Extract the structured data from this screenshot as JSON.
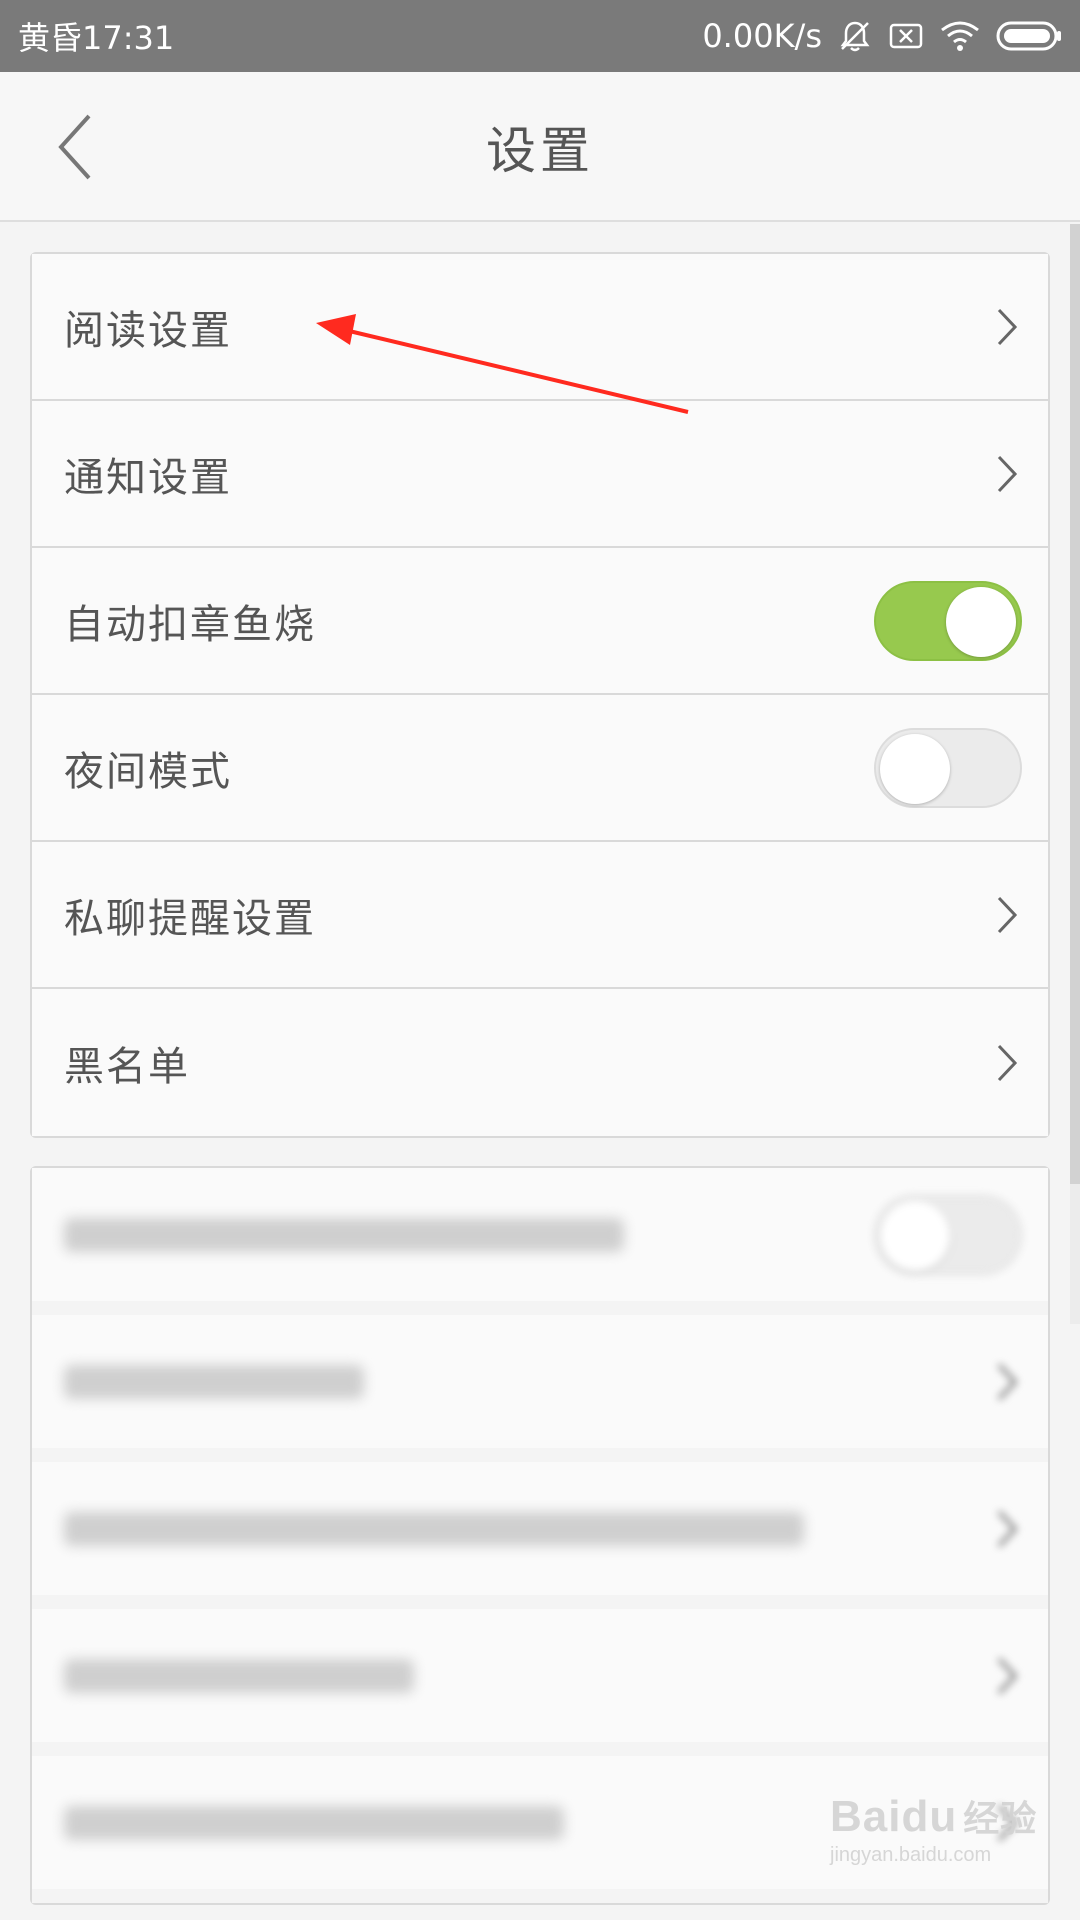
{
  "status_bar": {
    "time": "黄昏17:31",
    "network_speed": "0.00K/s",
    "icons": [
      "bell-off-icon",
      "sim-off-icon",
      "wifi-icon",
      "battery-icon"
    ]
  },
  "header": {
    "title": "设置",
    "back_icon": "chevron-left-icon"
  },
  "settings_group_1": {
    "items": [
      {
        "label": "阅读设置",
        "control": "chevron"
      },
      {
        "label": "通知设置",
        "control": "chevron"
      },
      {
        "label": "自动扣章鱼烧",
        "control": "toggle",
        "on": true
      },
      {
        "label": "夜间模式",
        "control": "toggle",
        "on": false
      },
      {
        "label": "私聊提醒设置",
        "control": "chevron"
      },
      {
        "label": "黑名单",
        "control": "chevron"
      }
    ]
  },
  "settings_group_2": {
    "note": "blurred rows",
    "items": [
      {
        "control": "toggle",
        "on": false
      },
      {
        "control": "chevron"
      },
      {
        "control": "chevron"
      },
      {
        "control": "chevron"
      },
      {
        "control": "chevron"
      }
    ]
  },
  "watermark": {
    "brand": "Baidu",
    "brand_cn": "经验",
    "url": "jingyan.baidu.com"
  },
  "colors": {
    "status_bar": "#7a7a7a",
    "toggle_on": "#97c94e",
    "annotation_arrow": "#ff2a1f"
  }
}
